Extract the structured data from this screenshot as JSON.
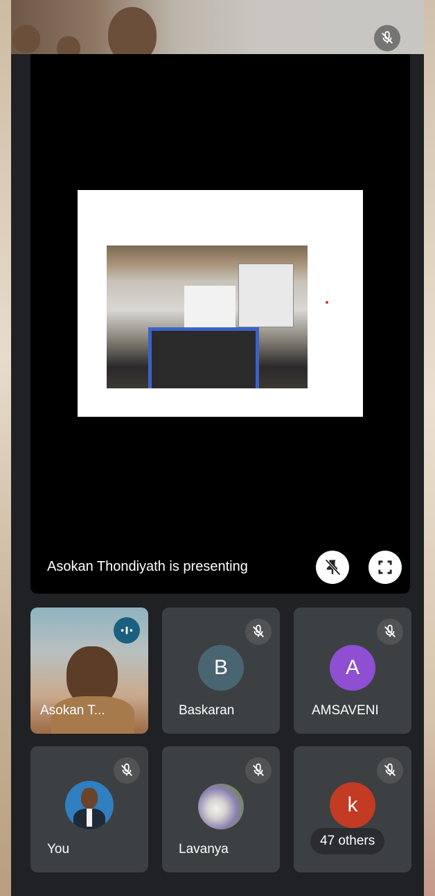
{
  "presentation": {
    "presenting_label": "Asokan Thondiyath is presenting"
  },
  "participants": [
    {
      "name": "Asokan T...",
      "type": "video",
      "speaking": true
    },
    {
      "name": "Baskaran",
      "avatar_letter": "B",
      "avatar_color": "#4a6572",
      "muted": true
    },
    {
      "name": "AMSAVENI",
      "avatar_letter": "A",
      "avatar_color": "#8e4fd3",
      "muted": true
    },
    {
      "name": "You",
      "type": "photo",
      "muted": true
    },
    {
      "name": "Lavanya",
      "type": "photo",
      "muted": true
    },
    {
      "name": "",
      "avatar_letter": "k",
      "avatar_color": "#c23b22",
      "muted": true,
      "others_label": "47 others"
    }
  ],
  "icons": {
    "top_tile": "mic-off-icon",
    "stop_presenting": "unpin-icon",
    "fullscreen": "fullscreen-icon",
    "speaking": "audio-wave-icon"
  },
  "colors": {
    "meeting_bg": "#202124",
    "tile_bg": "#3c4043",
    "speaking_badge": "#1a5f80"
  }
}
